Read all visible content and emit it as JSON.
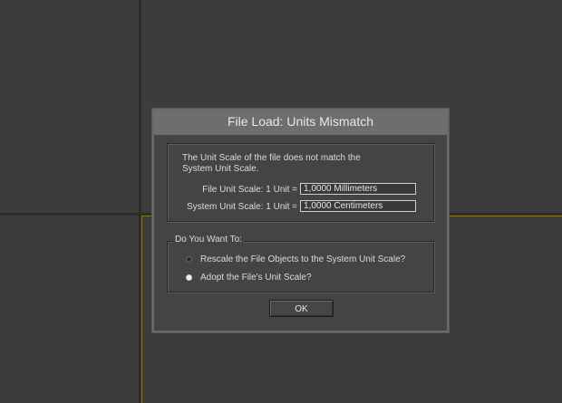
{
  "dialog": {
    "title": "File Load: Units Mismatch",
    "info": {
      "line1": "The Unit Scale of the file does not match the",
      "line2": "System Unit Scale.",
      "file_unit_label": "File Unit Scale: 1 Unit =",
      "file_unit_value": "1,0000 Millimeters",
      "system_unit_label": "System Unit Scale: 1 Unit =",
      "system_unit_value": "1,0000 Centimeters"
    },
    "options": {
      "legend": "Do You Want To:",
      "items": [
        {
          "label": "Rescale the File Objects to the System Unit Scale?",
          "checked": false
        },
        {
          "label": "Adopt the File's Unit Scale?",
          "checked": true
        }
      ]
    },
    "ok_label": "OK"
  },
  "colors": {
    "viewport": "#3c3c3c",
    "viewport_divider": "#2c2c2c",
    "active_viewport_border": "#8a7a2a",
    "dialog_bg": "#444444",
    "titlebar": "#6e6e6e"
  }
}
